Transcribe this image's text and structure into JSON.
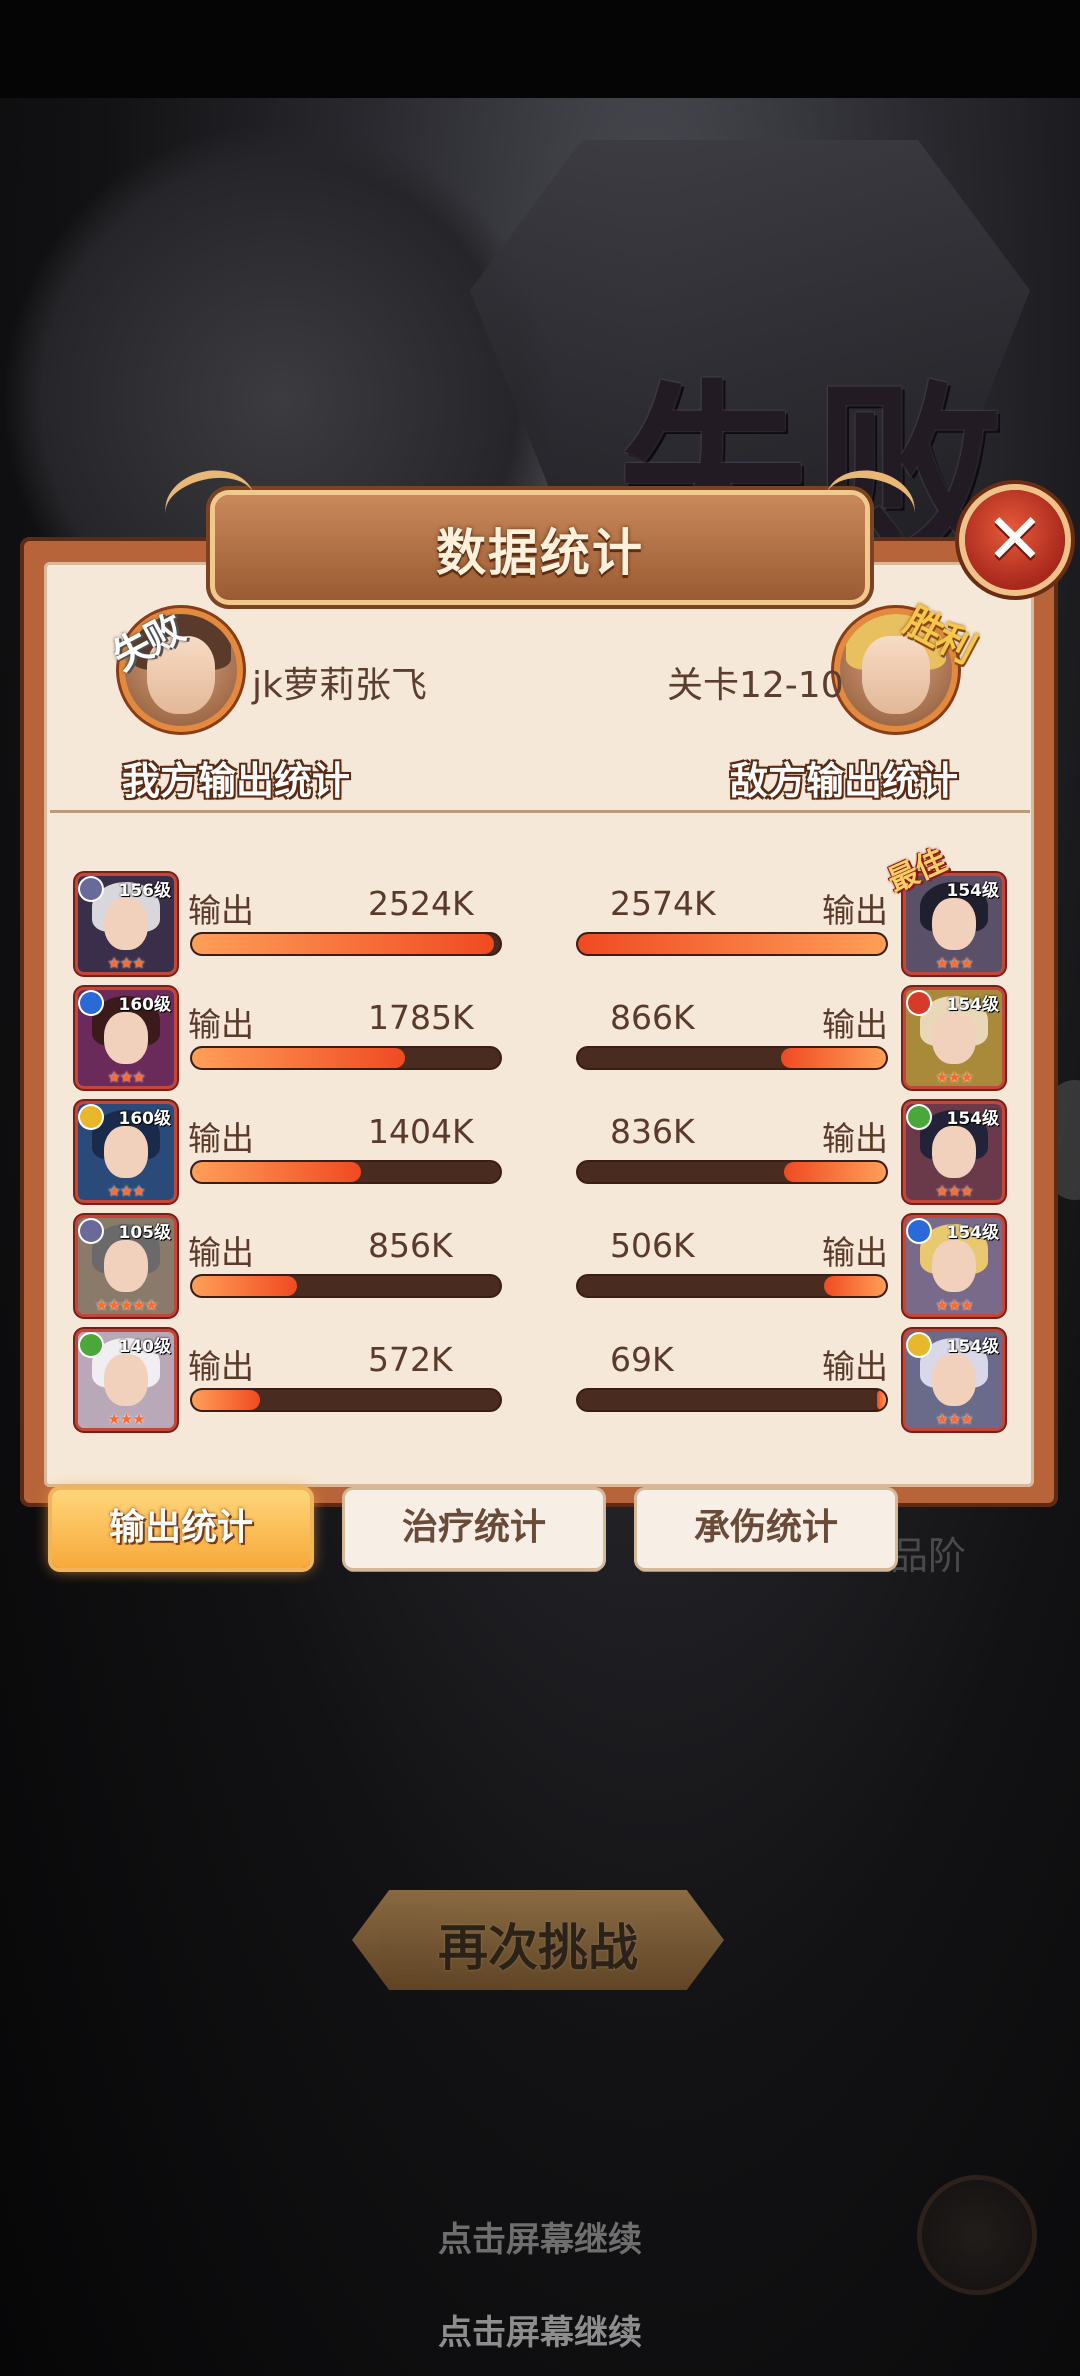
{
  "background": {
    "result_title": "失败",
    "dim_label": "品阶"
  },
  "panel": {
    "title": "数据统计",
    "close_icon": "close-icon"
  },
  "player": {
    "name": "jk萝莉张飞",
    "stamp": "失败",
    "side_title": "我方输出统计"
  },
  "enemy": {
    "name": "关卡12-10",
    "stamp": "胜利",
    "side_title": "敌方输出统计"
  },
  "stat_label": "输出",
  "best_tag": "最佳",
  "rows": [
    {
      "left": {
        "level": "156级",
        "value": "2524K",
        "ratio": 0.98,
        "stars": "★★★",
        "elem": "#6a6a9a",
        "hair": "#d8d8dc",
        "bg": "#3a2f4a"
      },
      "right": {
        "level": "154级",
        "value": "2574K",
        "ratio": 1.0,
        "stars": "★★★",
        "elem": "",
        "hair": "#1f1f2e",
        "bg": "#5a5068",
        "best": true
      }
    },
    {
      "left": {
        "level": "160级",
        "value": "1785K",
        "ratio": 0.69,
        "stars": "★★★",
        "elem": "#2a6ad8",
        "hair": "#3a1a1a",
        "bg": "#6a2a5a"
      },
      "right": {
        "level": "154级",
        "value": "866K",
        "ratio": 0.34,
        "stars": "★★★",
        "elem": "#d83a2a",
        "hair": "#e8d8b8",
        "bg": "#a88a3a"
      }
    },
    {
      "left": {
        "level": "160级",
        "value": "1404K",
        "ratio": 0.55,
        "stars": "★★★",
        "elem": "#e8b82a",
        "hair": "#1a2a4a",
        "bg": "#2a4a7a"
      },
      "right": {
        "level": "154级",
        "value": "836K",
        "ratio": 0.33,
        "stars": "★★★",
        "elem": "#4aa83a",
        "hair": "#222238",
        "bg": "#6a3a4a"
      }
    },
    {
      "left": {
        "level": "105级",
        "value": "856K",
        "ratio": 0.34,
        "stars": "★★★★★",
        "elem": "#6a6a9a",
        "hair": "#6a6a6a",
        "bg": "#8a7a6a"
      },
      "right": {
        "level": "154级",
        "value": "506K",
        "ratio": 0.2,
        "stars": "★★★",
        "elem": "#2a6ad8",
        "hair": "#e8c870",
        "bg": "#7a6a8a"
      }
    },
    {
      "left": {
        "level": "140级",
        "value": "572K",
        "ratio": 0.22,
        "stars": "★★★",
        "elem": "#4aa83a",
        "hair": "#f0eef0",
        "bg": "#b8a8b8"
      },
      "right": {
        "level": "154级",
        "value": "69K",
        "ratio": 0.03,
        "stars": "★★★",
        "elem": "#e8b82a",
        "hair": "#d8d8e8",
        "bg": "#6a6a8a"
      }
    }
  ],
  "tabs": [
    {
      "label": "输出统计",
      "active": true
    },
    {
      "label": "治疗统计",
      "active": false
    },
    {
      "label": "承伤统计",
      "active": false
    }
  ],
  "retry_button": "再次挑战",
  "continue_text_1": "点击屏幕继续",
  "continue_text_2": "点击屏幕继续"
}
